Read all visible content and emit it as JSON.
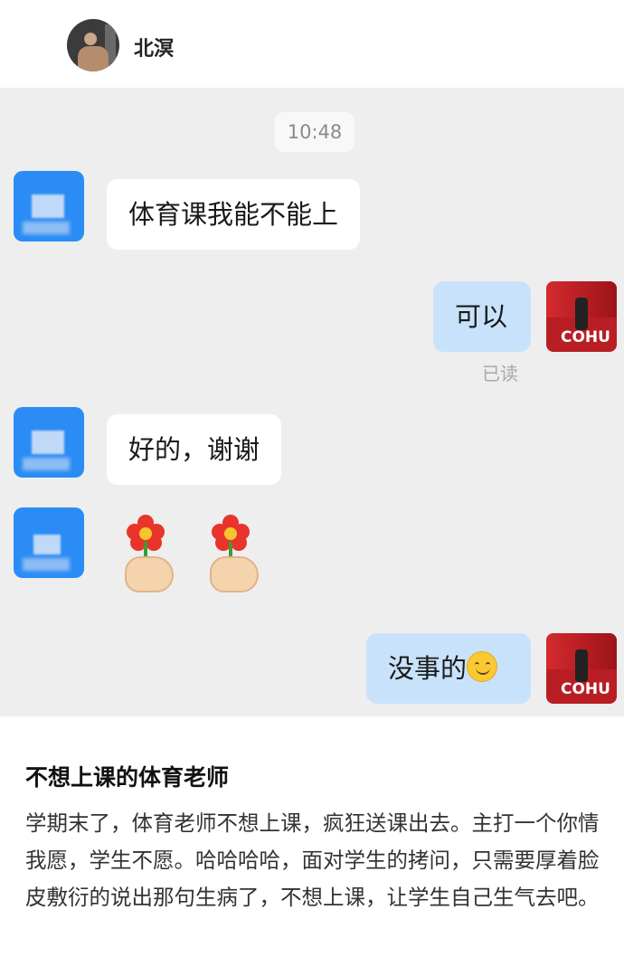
{
  "header": {
    "contact_name": "北溟",
    "avatar_icon": "profile-photo-icon"
  },
  "chat": {
    "timestamp": "10:48",
    "messages": [
      {
        "side": "left",
        "text": "体育课我能不能上"
      },
      {
        "side": "right",
        "text": "可以",
        "status": "已读"
      },
      {
        "side": "left",
        "text": "好的，谢谢"
      },
      {
        "side": "left",
        "emoji": [
          "flower-in-hand-icon",
          "flower-in-hand-icon"
        ]
      },
      {
        "side": "right",
        "text": "没事的",
        "emoji": "smiling-face-icon"
      }
    ],
    "right_avatar_brand": "COHU",
    "colors": {
      "background": "#eeeeee",
      "outgoing_bubble": "#c9e2fb",
      "incoming_bubble": "#ffffff",
      "left_avatar": "#2b8cf5"
    }
  },
  "article": {
    "title": "不想上课的体育老师",
    "body": "学期末了，体育老师不想上课，疯狂送课出去。主打一个你情我愿，学生不愿。哈哈哈哈，面对学生的拷问，只需要厚着脸皮敷衍的说出那句生病了，不想上课，让学生自己生气去吧。"
  }
}
